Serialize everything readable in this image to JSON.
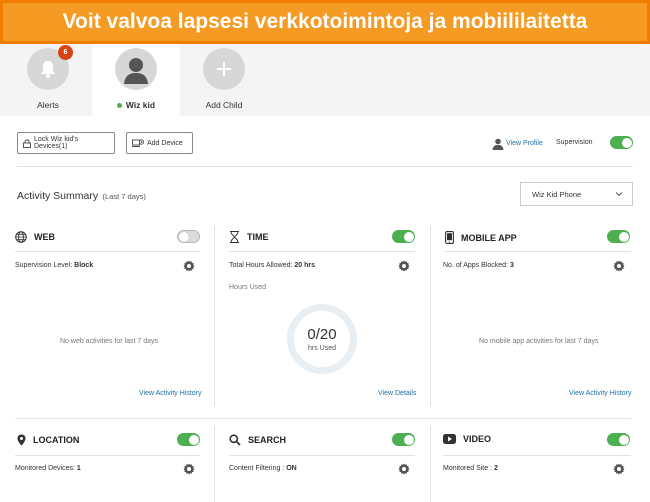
{
  "banner": {
    "text": "Voit valvoa lapsesi verkkotoimintoja ja mobiililaitetta"
  },
  "tabs": {
    "alerts": {
      "label": "Alerts",
      "badge": "6"
    },
    "child": {
      "label": "Wiz kid",
      "status": "online"
    },
    "add": {
      "label": "Add Child"
    }
  },
  "toolbar": {
    "lock_label": "Lock Wiz kid's Devices(1)",
    "add_device_label": "Add Device",
    "view_profile_label": "View Profile",
    "supervision_label": "Supervision",
    "supervision_on": true
  },
  "summary": {
    "title": "Activity Summary",
    "range": "(Last 7 days)",
    "device_selected": "Wiz Kid Phone"
  },
  "panels": {
    "web": {
      "title": "WEB",
      "enabled": false,
      "info_label": "Supervision Level:",
      "info_value": "Block",
      "empty_text": "No web activities for last 7 days",
      "link": "View Activity History"
    },
    "time": {
      "title": "TIME",
      "enabled": true,
      "info_label": "Total Hours Allowed:",
      "info_value": "20 hrs",
      "sub_label": "Hours Used",
      "ring_value": "0/20",
      "ring_sub": "hrs Used",
      "link": "View Details"
    },
    "mobile_app": {
      "title": "MOBILE APP",
      "enabled": true,
      "info_label": "No. of Apps Blocked:",
      "info_value": "3",
      "empty_text": "No mobile app activities for last 7 days",
      "link": "View Activity History"
    },
    "location": {
      "title": "LOCATION",
      "enabled": true,
      "info_label": "Monitored Devices:",
      "info_value": "1"
    },
    "search": {
      "title": "SEARCH",
      "enabled": true,
      "info_label": "Content Filtering :",
      "info_value": "ON"
    },
    "video": {
      "title": "VIDEO",
      "enabled": true,
      "info_label": "Monitored Site :",
      "info_value": "2"
    }
  },
  "colors": {
    "banner": "#f59a23",
    "toggle_on": "#4caf50",
    "link": "#1f6fa8",
    "badge": "#d84315"
  }
}
